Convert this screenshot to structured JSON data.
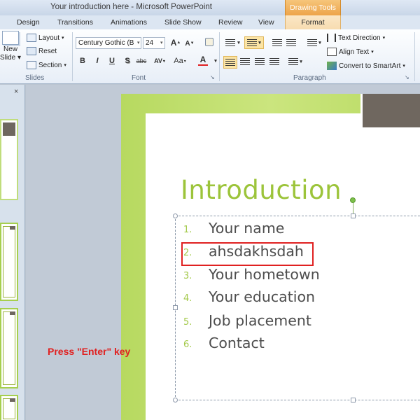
{
  "window": {
    "title": "Your introduction here  -  Microsoft PowerPoint",
    "context_group": "Drawing Tools"
  },
  "tabs": [
    "Design",
    "Transitions",
    "Animations",
    "Slide Show",
    "Review",
    "View"
  ],
  "context_tab": "Format",
  "ribbon": {
    "slides": {
      "new_slide_line1": "New",
      "new_slide_line2": "Slide",
      "layout": "Layout",
      "reset": "Reset",
      "section": "Section",
      "group_label": "Slides"
    },
    "font": {
      "font_name": "Century Gothic (B",
      "font_size": "24",
      "bold": "B",
      "italic": "I",
      "underline": "U",
      "shadow": "S",
      "strike": "abc",
      "spacing": "AV",
      "change_case": "Aa",
      "font_color": "A",
      "grow": "A",
      "shrink": "A",
      "group_label": "Font"
    },
    "paragraph": {
      "text_direction": "Text Direction",
      "align_text": "Align Text",
      "convert_smartart": "Convert to SmartArt",
      "group_label": "Paragraph"
    }
  },
  "slide": {
    "title": "Introduction",
    "items": [
      {
        "num": "1.",
        "text": "Your name"
      },
      {
        "num": "2.",
        "text": "ahsdakhsdah"
      },
      {
        "num": "3.",
        "text": "Your hometown"
      },
      {
        "num": "4.",
        "text": "Your education"
      },
      {
        "num": "5.",
        "text": "Job placement"
      },
      {
        "num": "6.",
        "text": "Contact"
      }
    ]
  },
  "annotation": {
    "instruction": "Press \"Enter\" key",
    "highlight_color": "#e02121"
  },
  "colors": {
    "accent_green": "#9cc43a",
    "context_orange": "#eda44a",
    "dark_box": "#6f675f"
  },
  "icons": {
    "pane_close": "×"
  }
}
